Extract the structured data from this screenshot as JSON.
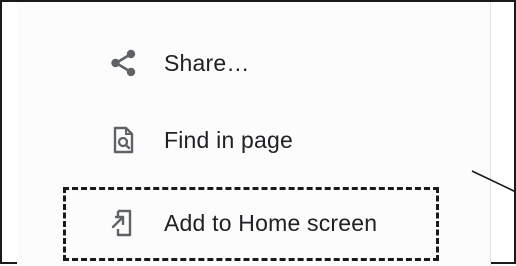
{
  "menu": {
    "items": [
      {
        "label": "Share…",
        "icon": "share-icon"
      },
      {
        "label": "Find in page",
        "icon": "find-in-page-icon"
      },
      {
        "label": "Add to Home screen",
        "icon": "add-to-home-screen-icon"
      }
    ]
  },
  "colors": {
    "text": "#202124",
    "icon": "#5f6368",
    "annotation": "#1a1a1a"
  }
}
